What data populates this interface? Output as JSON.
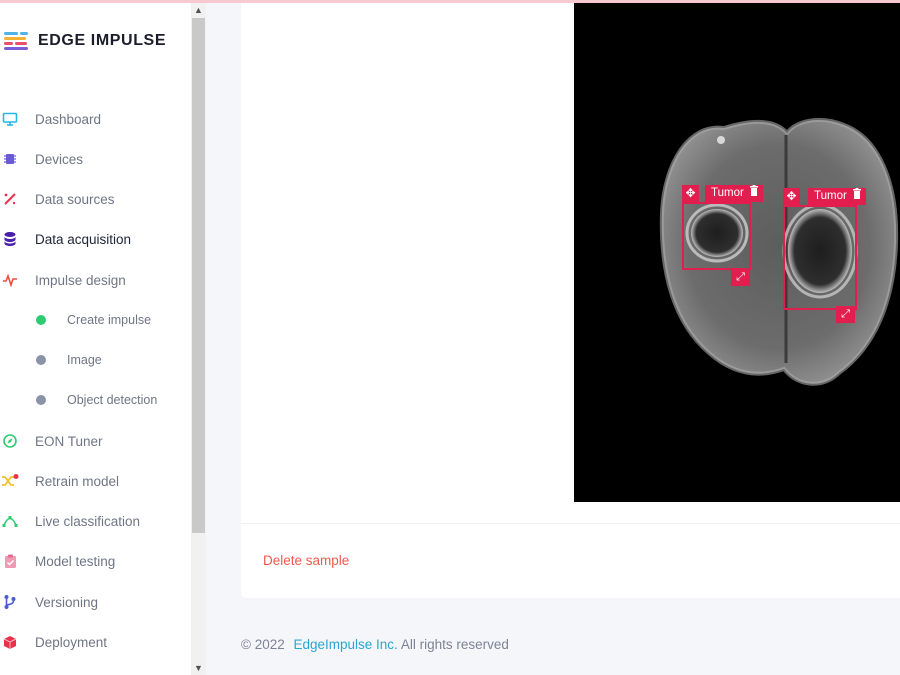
{
  "brand": {
    "name": "EDGE IMPULSE"
  },
  "sidebar": {
    "items": [
      {
        "label": "Dashboard",
        "icon": "monitor-icon"
      },
      {
        "label": "Devices",
        "icon": "chip-icon"
      },
      {
        "label": "Data sources",
        "icon": "wand-icon"
      },
      {
        "label": "Data acquisition",
        "icon": "database-icon",
        "active": true
      },
      {
        "label": "Impulse design",
        "icon": "pulse-icon"
      },
      {
        "label": "Create impulse",
        "sub": true,
        "dot_color": "#2ecc71"
      },
      {
        "label": "Image",
        "sub": true,
        "dot_color": "#8a93a8"
      },
      {
        "label": "Object detection",
        "sub": true,
        "dot_color": "#8a93a8"
      },
      {
        "label": "EON Tuner",
        "icon": "compass-icon"
      },
      {
        "label": "Retrain model",
        "icon": "shuffle-icon"
      },
      {
        "label": "Live classification",
        "icon": "bezier-icon"
      },
      {
        "label": "Model testing",
        "icon": "clipboard-check-icon"
      },
      {
        "label": "Versioning",
        "icon": "branch-icon"
      },
      {
        "label": "Deployment",
        "icon": "package-icon"
      }
    ]
  },
  "sample": {
    "labels": [
      {
        "label": "Tumor"
      },
      {
        "label": "Tumor"
      }
    ],
    "delete_label": "Delete sample"
  },
  "footer": {
    "copyright": "© 2022",
    "company": "EdgeImpulse Inc.",
    "rights": "All rights reserved"
  },
  "colors": {
    "accent": "#e11e4e",
    "delete": "#f25a4a",
    "link": "#2aa6d2"
  }
}
